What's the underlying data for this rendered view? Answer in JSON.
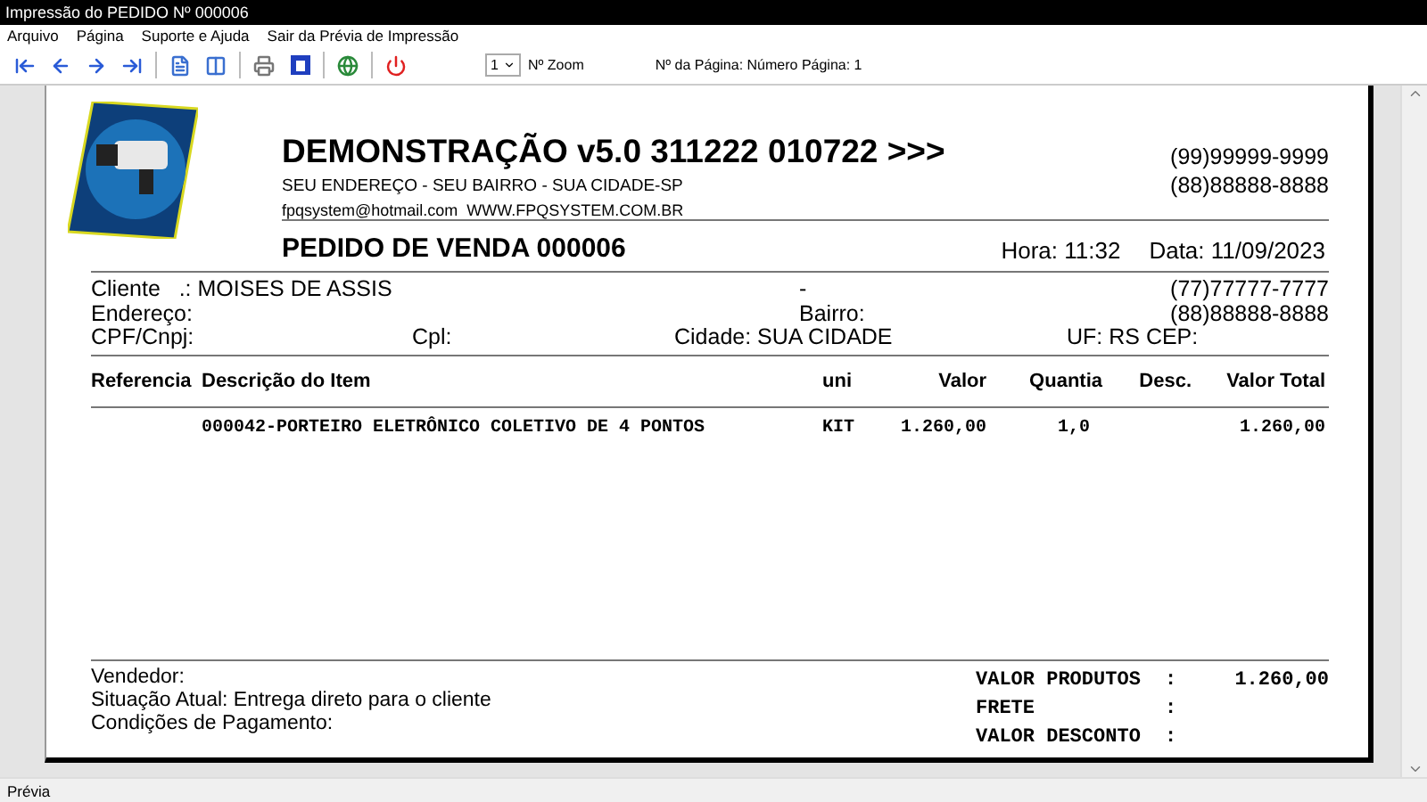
{
  "window": {
    "title": "Impressão do PEDIDO Nº 000006"
  },
  "menu": [
    "Arquivo",
    "Página",
    "Suporte e Ajuda",
    "Sair da Prévia de Impressão"
  ],
  "toolbar": {
    "zoom_value": "1",
    "zoom_label": "Nº Zoom",
    "page_label": "Nº da Página: Número Página: 1"
  },
  "document": {
    "company": {
      "title": "DEMONSTRAÇÃO v5.0 311222 010722 >>>",
      "address": "SEU ENDEREÇO - SEU BAIRRO - SUA CIDADE-SP",
      "contact": "fpqsystem@hotmail.com  WWW.FPQSYSTEM.COM.BR",
      "phones": [
        "(99)99999-9999",
        "(88)88888-8888"
      ]
    },
    "order_title": "PEDIDO DE VENDA 000006",
    "time": "Hora: 11:32",
    "date": "Data: 11/09/2023",
    "customer": {
      "name": "Cliente   .: MOISES DE ASSIS",
      "dash": "-",
      "phone_1": "(77)77777-7777",
      "address": "Endereço:",
      "district": "Bairro:",
      "phone_2": "(88)88888-8888",
      "tax_id": "CPF/Cnpj:",
      "complement": "Cpl:",
      "city": "Cidade: SUA CIDADE",
      "state": "UF: RS CEP:"
    },
    "columns": [
      "Referencia",
      "Descrição do Item",
      "uni",
      "Valor",
      "Quantia",
      "Desc.",
      "Valor Total"
    ],
    "items": [
      {
        "description": "000042-PORTEIRO ELETRÔNICO COLETIVO DE 4 PONTOS",
        "unit": "KIT",
        "price": "1.260,00",
        "quantity": "1,0",
        "total": "1.260,00"
      }
    ],
    "footer": [
      "Vendedor:",
      "Situação Atual: Entrega direto para o cliente",
      "Condições de Pagamento:"
    ],
    "totals": [
      {
        "label": "VALOR PRODUTOS",
        "colon": ":",
        "value": "1.260,00"
      },
      {
        "label": "FRETE",
        "colon": ":"
      },
      {
        "label": "VALOR DESCONTO",
        "colon": ":"
      }
    ]
  },
  "status_bar": "Prévia"
}
